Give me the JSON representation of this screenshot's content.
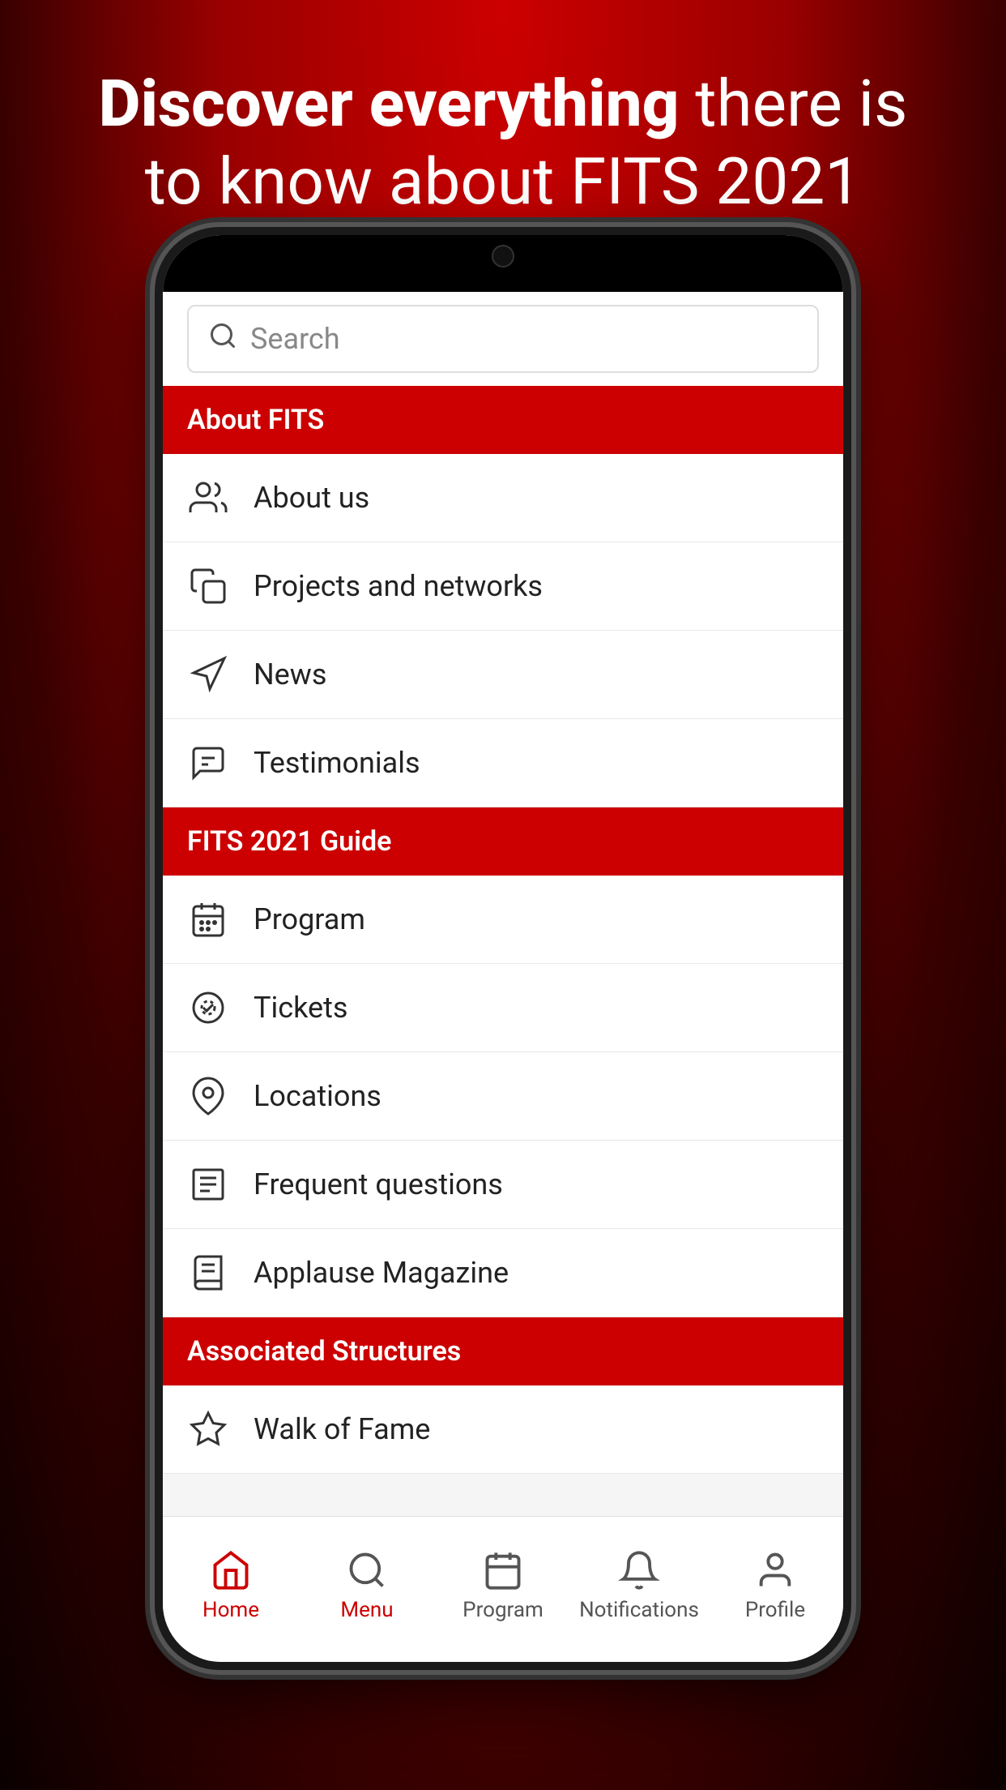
{
  "hero": {
    "line1_bold": "Discover everything",
    "line1_normal": " there is",
    "line2": "to know about FITS 2021"
  },
  "search": {
    "placeholder": "Search"
  },
  "sections": [
    {
      "header": "About FITS",
      "items": [
        {
          "id": "about-us",
          "label": "About us",
          "icon": "people"
        },
        {
          "id": "projects-networks",
          "label": "Projects and networks",
          "icon": "document-copy"
        },
        {
          "id": "news",
          "label": "News",
          "icon": "navigation"
        },
        {
          "id": "testimonials",
          "label": "Testimonials",
          "icon": "chat"
        }
      ]
    },
    {
      "header": "FITS 2021 Guide",
      "items": [
        {
          "id": "program",
          "label": "Program",
          "icon": "calendar"
        },
        {
          "id": "tickets",
          "label": "Tickets",
          "icon": "ticket"
        },
        {
          "id": "locations",
          "label": "Locations",
          "icon": "location"
        },
        {
          "id": "frequent-questions",
          "label": "Frequent questions",
          "icon": "list-text"
        },
        {
          "id": "applause-magazine",
          "label": "Applause Magazine",
          "icon": "book"
        }
      ]
    },
    {
      "header": "Associated Structures",
      "items": [
        {
          "id": "walk-of-fame",
          "label": "Walk of Fame",
          "icon": "star"
        }
      ]
    }
  ],
  "bottom_nav": [
    {
      "id": "home",
      "label": "Home",
      "icon": "home",
      "active": true
    },
    {
      "id": "menu",
      "label": "Menu",
      "icon": "menu",
      "active": false
    },
    {
      "id": "program",
      "label": "Program",
      "icon": "calendar-nav",
      "active": false
    },
    {
      "id": "notifications",
      "label": "Notifications",
      "icon": "bell",
      "active": false
    },
    {
      "id": "profile",
      "label": "Profile",
      "icon": "person",
      "active": false
    }
  ],
  "colors": {
    "accent": "#cc0000",
    "nav_active": "#cc0000",
    "nav_inactive": "#555555"
  }
}
